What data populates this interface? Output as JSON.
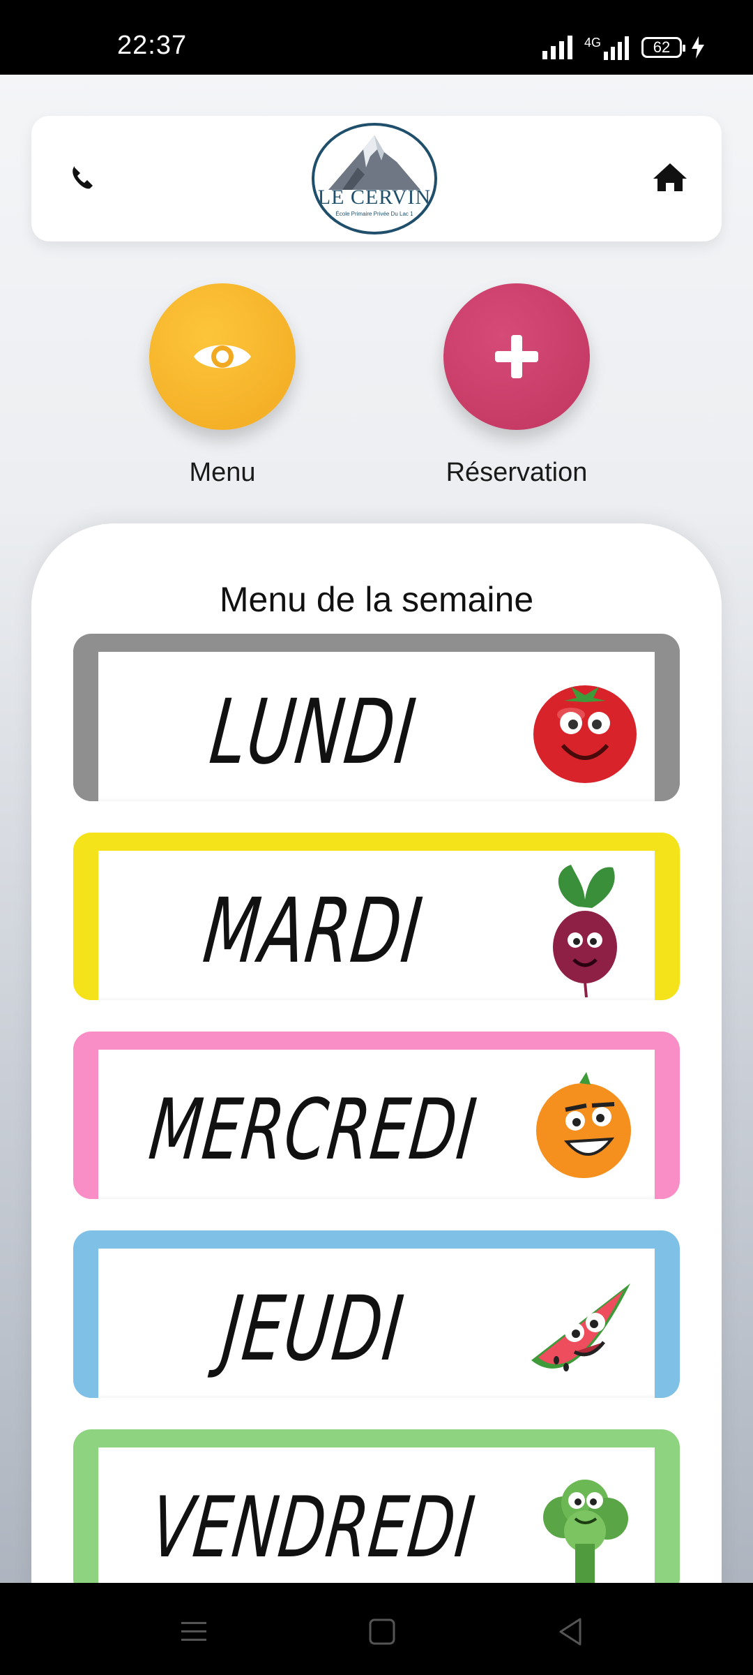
{
  "status": {
    "time": "22:37",
    "network": "4G",
    "battery": "62"
  },
  "header": {
    "logo_name": "LE CERVIN",
    "logo_subtitle": "École Primaire Privée Du Lac 1",
    "phone_icon": "phone-icon",
    "home_icon": "home-icon"
  },
  "actions": [
    {
      "label": "Menu",
      "icon": "eye-icon",
      "color": "#f4b02a"
    },
    {
      "label": "Réservation",
      "icon": "plus-icon",
      "color": "#c83e68"
    }
  ],
  "panel": {
    "title": "Menu de la semaine"
  },
  "days": [
    {
      "label": "LUNDI",
      "border_color": "#8f8f8f",
      "icon": "tomato-icon"
    },
    {
      "label": "MARDI",
      "border_color": "#f4e31a",
      "icon": "beet-icon"
    },
    {
      "label": "MERCREDI",
      "border_color": "#f98dc6",
      "icon": "orange-icon"
    },
    {
      "label": "JEUDI",
      "border_color": "#7fc1e6",
      "icon": "watermelon-icon"
    },
    {
      "label": "VENDREDI",
      "border_color": "#8ed37f",
      "icon": "broccoli-icon"
    }
  ],
  "nav": {
    "items": [
      "menu-nav-icon",
      "home-nav-icon",
      "back-nav-icon"
    ]
  }
}
